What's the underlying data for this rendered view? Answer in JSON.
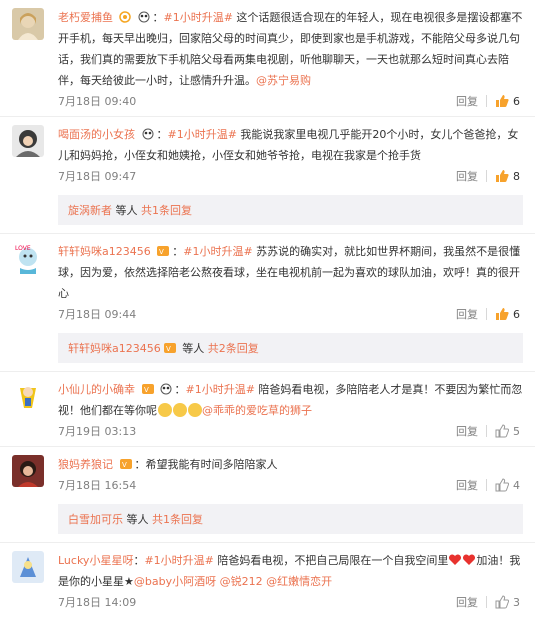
{
  "comments": [
    {
      "user": "老朽爱捕鱼",
      "text_pre": "：",
      "tag": "#1小时升温#",
      "text": " 这个话题很适合现在的年轻人，现在电视很多是摆设都塞不开手机，每天早出晚归，回家陪父母的时间真少，即使到家也是手机游戏，不能陪父母多说几句话，我们真的需要放下手机陪父母看两集电视剧，听他聊聊天，一天也就那么短时间真心去陪伴，每天给彼此一小时，让感情升升温。",
      "mention": "@苏宁易购",
      "time": "7月18日 09:40",
      "reply_label": "回复",
      "likes": "6"
    },
    {
      "user": "喝面汤的小女孩",
      "text_pre": "：",
      "tag": "#1小时升温#",
      "text": " 我能说我家里电视几乎能开20个小时，女儿个爸爸抢，女儿和妈妈抢，小侄女和她姨抢，小侄女和她爷爷抢，电视在我家是个抢手货",
      "mention": "",
      "time": "7月18日 09:47",
      "reply_label": "回复",
      "likes": "8",
      "sub": {
        "user": "旋涡新者",
        "text": " 等人 ",
        "more": "共1条回复"
      }
    },
    {
      "user": "轩轩妈咪a123456",
      "text_pre": "：",
      "tag": "#1小时升温#",
      "text": " 苏苏说的确实对，就比如世界杯期间，我虽然不是很懂球，因为爱，依然选择陪老公熬夜看球，坐在电视机前一起为喜欢的球队加油，欢呼！真的很开心",
      "mention": "",
      "time": "7月18日 09:44",
      "reply_label": "回复",
      "likes": "6",
      "sub": {
        "user": "轩轩妈咪a123456",
        "text": " 等人 ",
        "more": "共2条回复"
      }
    },
    {
      "user": "小仙儿的小确幸",
      "text_pre": "：",
      "tag": "#1小时升温#",
      "text": " 陪爸妈看电视，多陪陪老人才是真！不要因为繁忙而忽视！他们都在等你呢",
      "mention": "@乖乖的爱吃草的狮子",
      "time": "7月19日 03:13",
      "reply_label": "回复",
      "likes": "5"
    },
    {
      "user": "狼妈养狼记",
      "text_pre": "：",
      "tag": "",
      "text": "希望我能有时间多陪陪家人",
      "mention": "",
      "time": "7月18日 16:54",
      "reply_label": "回复",
      "likes": "4",
      "sub": {
        "user": "白雪加可乐",
        "text": " 等人 ",
        "more": "共1条回复"
      }
    },
    {
      "user": "Lucky小星星呀",
      "text_pre": "：",
      "tag": "#1小时升温#",
      "text": " 陪爸妈看电视，不把自己局限在一个自我空间里",
      "text_post": "加油！我是你的小星星",
      "mention": "@baby小阿酒呀",
      "mention2": "@锐212",
      "mention3": "@红嫩情恋开",
      "time": "7月18日 14:09",
      "reply_label": "回复",
      "likes": "3"
    }
  ],
  "colors": {
    "accent": "#eb7350",
    "meta": "#808080",
    "sub_bg": "#f2f2f5"
  },
  "icons": [
    "thumbs-up-icon",
    "vip-badge-icon",
    "panda-badge-icon"
  ]
}
